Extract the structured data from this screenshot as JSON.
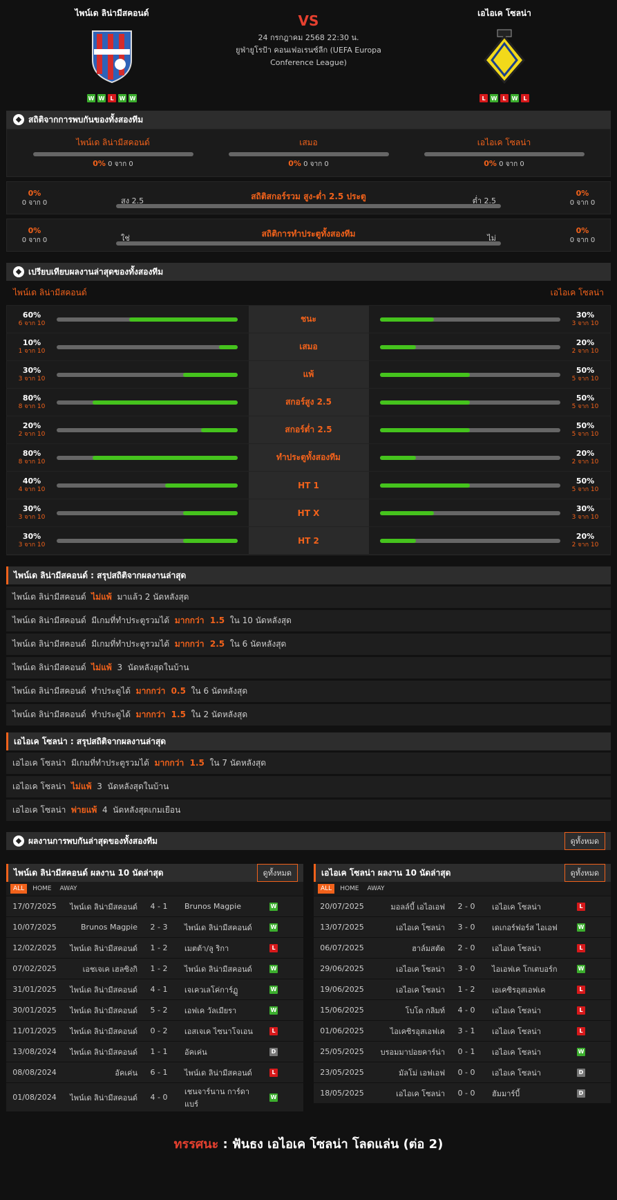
{
  "match": {
    "home": "ไพน์เด ลิน่ามีสคอนด์",
    "away": "เอไอเค โซลน่า",
    "vs": "VS",
    "date": "24 กรกฎาคม 2568 22:30 น.",
    "comp_line1": "ยูฟ่ายูโรป้า คอนเฟอเรนซ์ลีก (UEFA Europa",
    "comp_line2": "Conference League)",
    "home_form": [
      "W",
      "W",
      "L",
      "W",
      "W"
    ],
    "away_form": [
      "L",
      "W",
      "L",
      "W",
      "L"
    ]
  },
  "colors": {
    "accent": "#f2621b",
    "win": "#3cae2e",
    "loss": "#d7191b",
    "draw": "#777777",
    "bar": "#45c31d"
  },
  "h2h": {
    "title": "สถิติจากการพบกันของทั้งสองทีม",
    "cols": [
      {
        "label": "ไพน์เด ลิน่ามีสคอนด์",
        "pct": "0%",
        "of": "0 จาก 0"
      },
      {
        "label": "เสมอ",
        "pct": "0%",
        "of": "0 จาก 0"
      },
      {
        "label": "เอไอเค โซลน่า",
        "pct": "0%",
        "of": "0 จาก 0"
      }
    ],
    "ou": {
      "title": "สถิติสกอร์รวม สูง-ต่ำ 2.5 ประตู",
      "left_label": "สูง 2.5",
      "right_label": "ต่ำ 2.5",
      "lp": "0%",
      "lo": "0 จาก 0",
      "rp": "0%",
      "ro": "0 จาก 0"
    },
    "btts": {
      "title": "สถิติการทำประตูทั้งสองทีม",
      "left_label": "ใช่",
      "right_label": "ไม่",
      "lp": "0%",
      "lo": "0 จาก 0",
      "rp": "0%",
      "ro": "0 จาก 0"
    }
  },
  "compare": {
    "title": "เปรียบเทียบผลงานล่าสุดของทั้งสองทีม",
    "home": "ไพน์เด ลิน่ามีสคอนด์",
    "away": "เอไอเค โซลน่า",
    "rows": [
      {
        "label": "ชนะ",
        "hp": "60%",
        "hs": "6 จาก 10",
        "hv": 0.6,
        "ap": "30%",
        "as": "3 จาก 10",
        "av": 0.3
      },
      {
        "label": "เสมอ",
        "hp": "10%",
        "hs": "1 จาก 10",
        "hv": 0.1,
        "ap": "20%",
        "as": "2 จาก 10",
        "av": 0.2
      },
      {
        "label": "แพ้",
        "hp": "30%",
        "hs": "3 จาก 10",
        "hv": 0.3,
        "ap": "50%",
        "as": "5 จาก 10",
        "av": 0.5
      },
      {
        "label": "สกอร์สูง 2.5",
        "hp": "80%",
        "hs": "8 จาก 10",
        "hv": 0.8,
        "ap": "50%",
        "as": "5 จาก 10",
        "av": 0.5
      },
      {
        "label": "สกอร์ต่ำ 2.5",
        "hp": "20%",
        "hs": "2 จาก 10",
        "hv": 0.2,
        "ap": "50%",
        "as": "5 จาก 10",
        "av": 0.5
      },
      {
        "label": "ทำประตูทั้งสองทีม",
        "hp": "80%",
        "hs": "8 จาก 10",
        "hv": 0.8,
        "ap": "20%",
        "as": "2 จาก 10",
        "av": 0.2
      },
      {
        "label": "HT 1",
        "hp": "40%",
        "hs": "4 จาก 10",
        "hv": 0.4,
        "ap": "50%",
        "as": "5 จาก 10",
        "av": 0.5
      },
      {
        "label": "HT X",
        "hp": "30%",
        "hs": "3 จาก 10",
        "hv": 0.3,
        "ap": "30%",
        "as": "3 จาก 10",
        "av": 0.3
      },
      {
        "label": "HT 2",
        "hp": "30%",
        "hs": "3 จาก 10",
        "hv": 0.3,
        "ap": "20%",
        "as": "2 จาก 10",
        "av": 0.2
      }
    ]
  },
  "home_summary": {
    "title": "ไพน์เด ลิน่ามีสคอนด์ : สรุปสถิติจากผลงานล่าสุด",
    "rows": [
      [
        "ไพน์เด ลิน่ามีสคอนด์  ",
        "ไม่แพ้",
        "  มาแล้ว 2 นัดหลังสุด"
      ],
      [
        "ไพน์เด ลิน่ามีสคอนด์  มีเกมที่ทำประตูรวมได้  ",
        "มากกว่า  1.5",
        "  ใน 10 นัดหลังสุด"
      ],
      [
        "ไพน์เด ลิน่ามีสคอนด์  มีเกมที่ทำประตูรวมได้  ",
        "มากกว่า  2.5",
        "  ใน 6 นัดหลังสุด"
      ],
      [
        "ไพน์เด ลิน่ามีสคอนด์  ",
        "ไม่แพ้",
        "  3  นัดหลังสุดในบ้าน"
      ],
      [
        "ไพน์เด ลิน่ามีสคอนด์  ทำประตูได้  ",
        "มากกว่า  0.5",
        "  ใน 6 นัดหลังสุด"
      ],
      [
        "ไพน์เด ลิน่ามีสคอนด์  ทำประตูได้  ",
        "มากกว่า  1.5",
        "  ใน 2 นัดหลังสุด"
      ]
    ]
  },
  "away_summary": {
    "title": "เอไอเค โซลน่า : สรุปสถิติจากผลงานล่าสุด",
    "rows": [
      [
        "เอไอเค โซลน่า  มีเกมที่ทำประตูรวมได้  ",
        "มากกว่า  1.5",
        "  ใน 7 นัดหลังสุด"
      ],
      [
        "เอไอเค โซลน่า  ",
        "ไม่แพ้",
        "  3  นัดหลังสุดในบ้าน"
      ],
      [
        "เอไอเค โซลน่า  ",
        "พ่ายแพ้",
        "  4  นัดหลังสุดเกมเยือน"
      ]
    ]
  },
  "recent": {
    "title": "ผลงานการพบกันล่าสุดของทั้งสองทีม",
    "see_all": "ดูทั้งหมด",
    "tabs": [
      "ALL",
      "HOME",
      "AWAY"
    ],
    "home_title": "ไพน์เด ลิน่ามีสคอนด์ ผลงาน 10 นัดล่าสุด",
    "away_title": "เอไอเค โซลน่า ผลงาน 10 นัดล่าสุด",
    "home_matches": [
      [
        "17/07/2025",
        "ไพน์เด ลิน่ามีสคอนด์",
        "4 - 1",
        "Brunos Magpie",
        "W"
      ],
      [
        "10/07/2025",
        "Brunos Magpie",
        "2 - 3",
        "ไพน์เด ลิน่ามีสคอนด์",
        "W"
      ],
      [
        "12/02/2025",
        "ไพน์เด ลิน่ามีสคอนด์",
        "1 - 2",
        "เมตต้า/ลู ริกา",
        "L"
      ],
      [
        "07/02/2025",
        "เอชเจเค เฮลซิงกิ",
        "1 - 2",
        "ไพน์เด ลิน่ามีสคอนด์",
        "W"
      ],
      [
        "31/01/2025",
        "ไพน์เด ลิน่ามีสคอนด์",
        "4 - 1",
        "เจเควเลโค่การ์ฏู",
        "W"
      ],
      [
        "30/01/2025",
        "ไพน์เด ลิน่ามีสคอนด์",
        "5 - 2",
        "เอฟเค วัลเมียรา",
        "W"
      ],
      [
        "11/01/2025",
        "ไพน์เด ลิน่ามีสคอนด์",
        "0 - 2",
        "เอสเจเค ไซนาโจเอน",
        "L"
      ],
      [
        "13/08/2024",
        "ไพน์เด ลิน่ามีสคอนด์",
        "1 - 1",
        "อัคเค่น",
        "D"
      ],
      [
        "08/08/2024",
        "อัคเค่น",
        "6 - 1",
        "ไพน์เด ลิน่ามีสคอนด์",
        "L"
      ],
      [
        "01/08/2024",
        "ไพน์เด ลิน่ามีสคอนด์",
        "4 - 0",
        "เชนจาร์นาน การ์ดาแบร์",
        "W"
      ]
    ],
    "away_matches": [
      [
        "20/07/2025",
        "มอลล์บี้ เอไอเอฟ",
        "2 - 0",
        "เอไอเค โซลน่า",
        "L"
      ],
      [
        "13/07/2025",
        "เอไอเค โซลน่า",
        "3 - 0",
        "เดเกอร์ฟอร์ส ไอเอฟ",
        "W"
      ],
      [
        "06/07/2025",
        "ฮาล์มสตัด",
        "2 - 0",
        "เอไอเค โซลน่า",
        "L"
      ],
      [
        "29/06/2025",
        "เอไอเค โซลน่า",
        "3 - 0",
        "ไอเอฟเค โกเตบอร์ก",
        "W"
      ],
      [
        "19/06/2025",
        "เอไอเค โซลน่า",
        "1 - 2",
        "เอเคซิรอุสเอฟเค",
        "L"
      ],
      [
        "15/06/2025",
        "โบโด กลิมท์",
        "4 - 0",
        "เอไอเค โซลน่า",
        "L"
      ],
      [
        "01/06/2025",
        "ไอเคซิรอุสเอฟเค",
        "3 - 1",
        "เอไอเค โซลน่า",
        "L"
      ],
      [
        "25/05/2025",
        "บรอมมาปอยคาร์น่า",
        "0 - 1",
        "เอไอเค โซลน่า",
        "W"
      ],
      [
        "23/05/2025",
        "มัลโม่ เอฟเอฟ",
        "0 - 0",
        "เอไอเค โซลน่า",
        "D"
      ],
      [
        "18/05/2025",
        "เอไอเค โซลน่า",
        "0 - 0",
        "ฮัมมาร์บี้",
        "D"
      ]
    ]
  },
  "tip": {
    "label": "ทรรศนะ",
    "sep": " :  ",
    "text": "ฟันธง เอไอเค โซลน่า โลดแล่น (ต่อ 2)"
  }
}
